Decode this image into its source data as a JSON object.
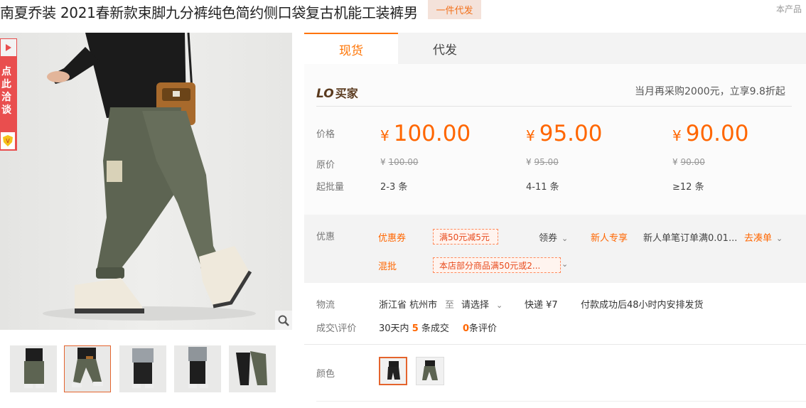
{
  "header": {
    "product_title": "南夏乔装 2021春新款束脚九分裤纯色简约侧口袋复古机能工装裤男",
    "badge": "一件代发",
    "right_note": "本产品"
  },
  "gallery": {
    "side_tab_text": "点此洽谈",
    "thumbnail_count": 5,
    "selected_index": 1
  },
  "tabs": [
    {
      "label": "现货",
      "active": true
    },
    {
      "label": "代发",
      "active": false
    }
  ],
  "buyer": {
    "logo_text": "LO",
    "logo_label": "买家",
    "promo": "当月再采购2000元，立享9.8折起"
  },
  "pricing": {
    "price_label": "价格",
    "orig_label": "原价",
    "moq_label": "起批量",
    "currency": "¥",
    "tiers": [
      {
        "price": "100.00",
        "orig": "100.00",
        "moq": "2-3 条"
      },
      {
        "price": "95.00",
        "orig": "95.00",
        "moq": "4-11 条"
      },
      {
        "price": "90.00",
        "orig": "90.00",
        "moq": "≥12 条"
      }
    ]
  },
  "discount": {
    "label": "优惠",
    "coupon_label": "优惠券",
    "coupon_value": "满50元减5元",
    "get_coupon": "领券",
    "newcomer_label": "新人专享",
    "newcomer_text": "新人单笔订单满0.01...",
    "go_order": "去凑单",
    "mix_label": "混批",
    "mix_value": "本店部分商品满50元或2..."
  },
  "shipping": {
    "logistics_label": "物流",
    "from": "浙江省 杭州市",
    "to_word": "至",
    "select": "请选择",
    "express": "快递 ¥7",
    "dispatch": "付款成功后48小时内安排发货",
    "deals_label": "成交\\评价",
    "deals_prefix": "30天内",
    "deals_count": "5",
    "deals_suffix": "条成交",
    "reviews_count": "0",
    "reviews_suffix": "条评价"
  },
  "color": {
    "label": "颜色",
    "options": 2,
    "selected_index": 0
  },
  "colors": {
    "accent": "#ff6600",
    "tab_accent": "#ff7300",
    "side_tab": "#e94e4e"
  }
}
